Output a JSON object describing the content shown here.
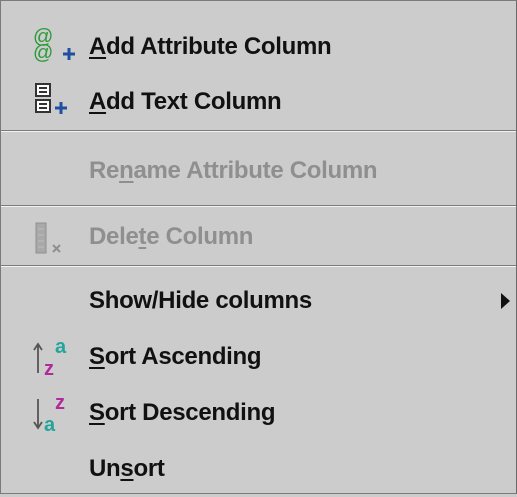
{
  "menu": {
    "items": [
      {
        "label": "Add Attribute Column",
        "enabled": true,
        "mnemonic_index": 0,
        "icon": "add-attribute-icon"
      },
      {
        "label": "Add Text Column",
        "enabled": true,
        "mnemonic_index": 0,
        "icon": "add-text-column-icon"
      },
      {
        "label": "Rename Attribute Column",
        "enabled": false,
        "mnemonic_index": 2,
        "icon": ""
      },
      {
        "label": "Delete Column",
        "enabled": false,
        "mnemonic_index": 4,
        "icon": "delete-column-icon"
      },
      {
        "label": "Show/Hide columns",
        "enabled": true,
        "mnemonic_index": -1,
        "icon": "",
        "submenu": true
      },
      {
        "label": "Sort Ascending",
        "enabled": true,
        "mnemonic_index": 0,
        "icon": "sort-ascending-icon"
      },
      {
        "label": "Sort Descending",
        "enabled": true,
        "mnemonic_index": 0,
        "icon": "sort-descending-icon"
      },
      {
        "label": "Unsort",
        "enabled": true,
        "mnemonic_index": 2,
        "icon": ""
      }
    ]
  },
  "colors": {
    "background": "#cccccc",
    "text": "#111111",
    "disabled": "#8f8f8f",
    "green": "#2a9a38",
    "blue": "#1f4fa0",
    "magenta": "#b02a9e",
    "teal": "#22a59a"
  }
}
